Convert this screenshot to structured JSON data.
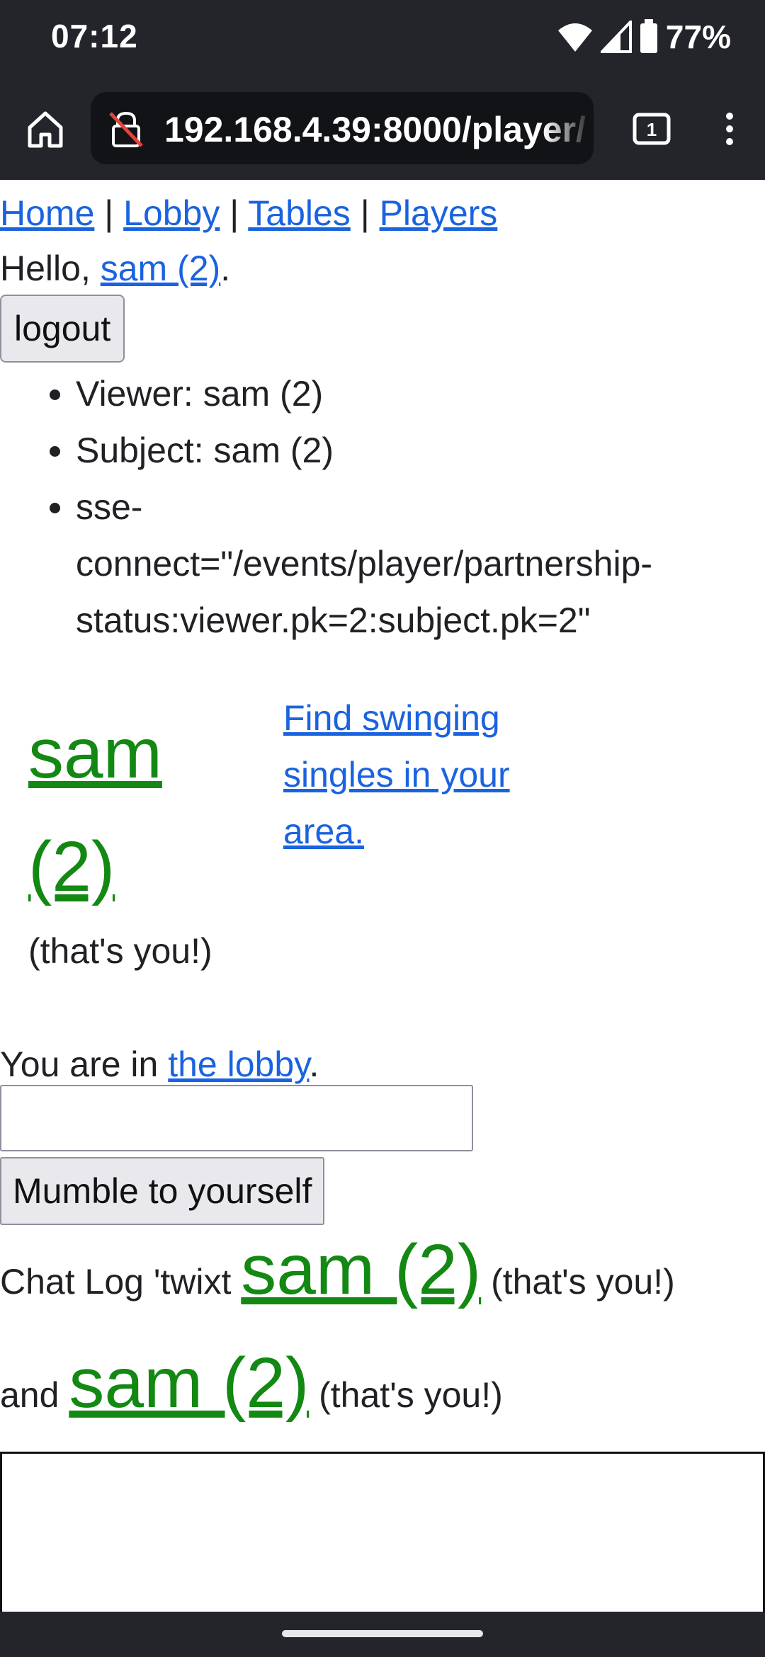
{
  "status_bar": {
    "time": "07:12",
    "battery": "77%"
  },
  "browser": {
    "url": "192.168.4.39:8000/player/",
    "tab_count": "1"
  },
  "nav": {
    "home": "Home",
    "lobby": "Lobby",
    "tables": "Tables",
    "players": "Players",
    "sep": " | "
  },
  "greeting": {
    "prefix": "Hello, ",
    "user": "sam (2)",
    "suffix": "."
  },
  "logout_label": "logout",
  "info_items": [
    "Viewer: sam (2)",
    "Subject: sam (2)",
    "sse-connect=\"/events/player/partnership-status:viewer.pk=2:subject.pk=2\""
  ],
  "profile": {
    "name": "sam (2)",
    "thats_you": "(that's you!)",
    "find_link": "Find swinging singles in your area."
  },
  "location": {
    "prefix": "You are in ",
    "place": "the lobby",
    "suffix": "."
  },
  "chat": {
    "input_value": "",
    "send_label": "Mumble to yourself",
    "log_prefix": "Chat Log 'twixt ",
    "name1": "sam (2)",
    "thats_you": " (that's you!)",
    "and": "and ",
    "name2": "sam (2)"
  },
  "colors": {
    "link": "#1a63e0",
    "player_green": "#138813",
    "chrome": "#24252b"
  }
}
